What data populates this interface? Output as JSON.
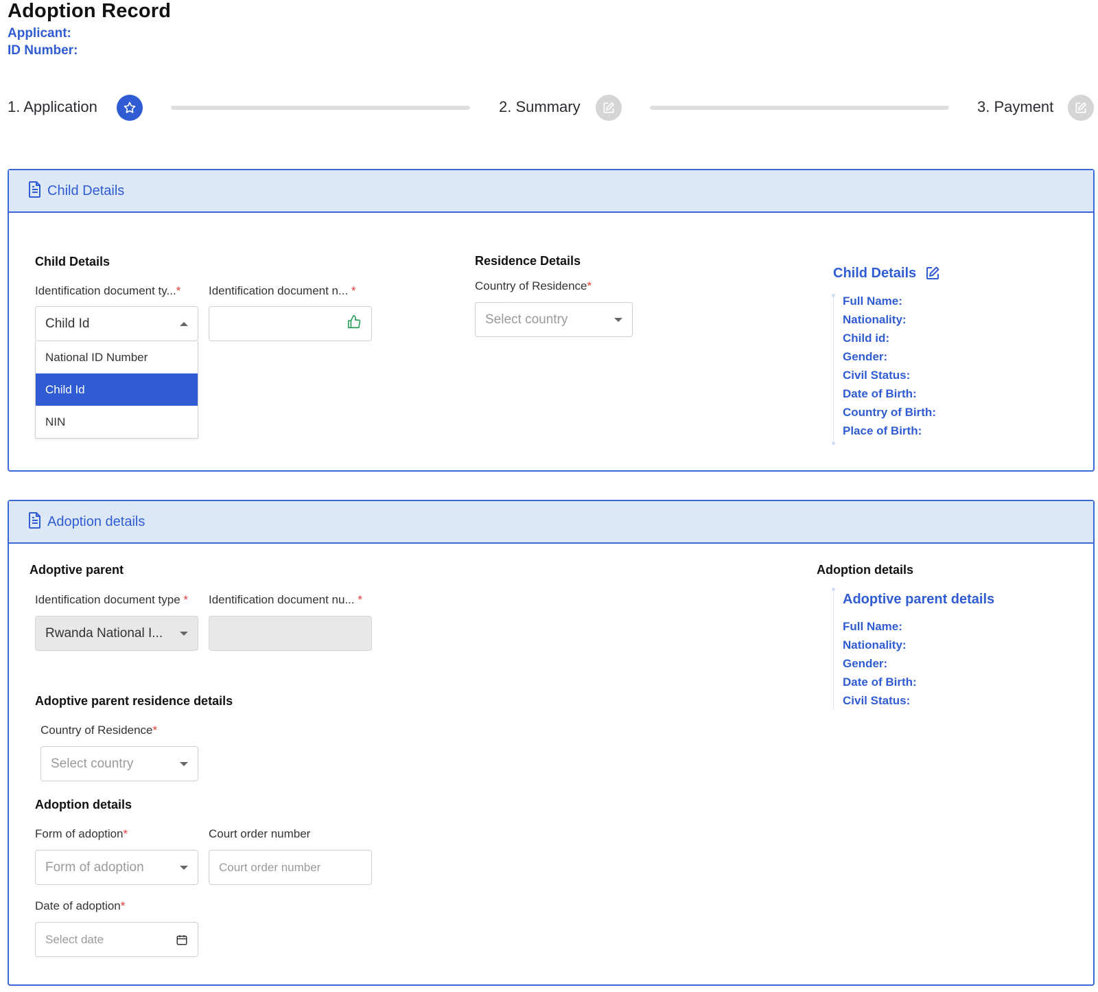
{
  "header": {
    "title": "Adoption Record",
    "applicant_label": "Applicant:",
    "id_number_label": "ID Number:"
  },
  "stepper": {
    "steps": [
      {
        "label": "1. Application",
        "state": "active",
        "icon": "star-icon"
      },
      {
        "label": "2. Summary",
        "state": "inactive",
        "icon": "edit-icon"
      },
      {
        "label": "3. Payment",
        "state": "inactive",
        "icon": "edit-icon"
      }
    ]
  },
  "child_card": {
    "header": "Child Details",
    "left_heading": "Child Details",
    "id_type_label": "Identification document ty...",
    "id_type_value": "Child Id",
    "id_type_options": [
      "National ID Number",
      "Child Id",
      "NIN"
    ],
    "id_number_label": "Identification document n...",
    "id_number_value": "",
    "residence_heading": "Residence Details",
    "country_label": "Country of Residence",
    "country_placeholder": "Select country",
    "summary": {
      "title": "Child Details",
      "lines": [
        "Full Name:",
        "Nationality:",
        "Child id:",
        "Gender:",
        "Civil Status:",
        "Date of Birth:",
        "Country of Birth:",
        "Place of Birth:"
      ]
    }
  },
  "adoption_card": {
    "header": "Adoption details",
    "parent_heading": "Adoptive parent",
    "id_type_label": "Identification document type",
    "id_type_value": "Rwanda National I...",
    "id_number_label": "Identification document nu...",
    "residence_heading": "Adoptive parent residence details",
    "country_label": "Country of Residence",
    "country_placeholder": "Select country",
    "details_heading": "Adoption details",
    "form_label": "Form of adoption",
    "form_placeholder": "Form of adoption",
    "court_label": "Court order number",
    "court_placeholder": "Court order number",
    "date_label": "Date of adoption",
    "date_placeholder": "Select date",
    "summary": {
      "heading": "Adoption details",
      "title": "Adoptive parent details",
      "lines": [
        "Full Name:",
        "Nationality:",
        "Gender:",
        "Date of Birth:",
        "Civil Status:"
      ]
    }
  },
  "required_mark": "*",
  "colors": {
    "accent": "#2f5bd3",
    "header_bg": "#dde8f7",
    "required": "#e53935",
    "success_icon": "#2e9e5b"
  }
}
